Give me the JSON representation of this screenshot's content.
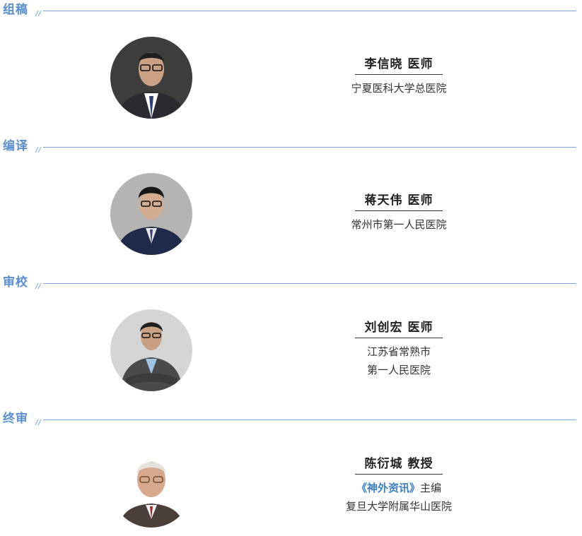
{
  "sections": [
    {
      "title": "组稿",
      "person": {
        "name": "李信晓 医师",
        "lines": [
          "宁夏医科大学总医院"
        ]
      }
    },
    {
      "title": "编译",
      "person": {
        "name": "蒋天伟 医师",
        "lines": [
          "常州市第一人民医院"
        ]
      }
    },
    {
      "title": "审校",
      "person": {
        "name": "刘创宏 医师",
        "lines": [
          "江苏省常熟市",
          "第一人民医院"
        ]
      }
    },
    {
      "title": "终审",
      "person": {
        "name": "陈衍城 教授",
        "publication": "《神外资讯》",
        "role": "主编",
        "lines": [
          "复旦大学附属华山医院"
        ]
      }
    }
  ],
  "colors": {
    "accent": "#5b8fd0",
    "rule": "#7da7d9",
    "publication": "#3a7fc4"
  }
}
